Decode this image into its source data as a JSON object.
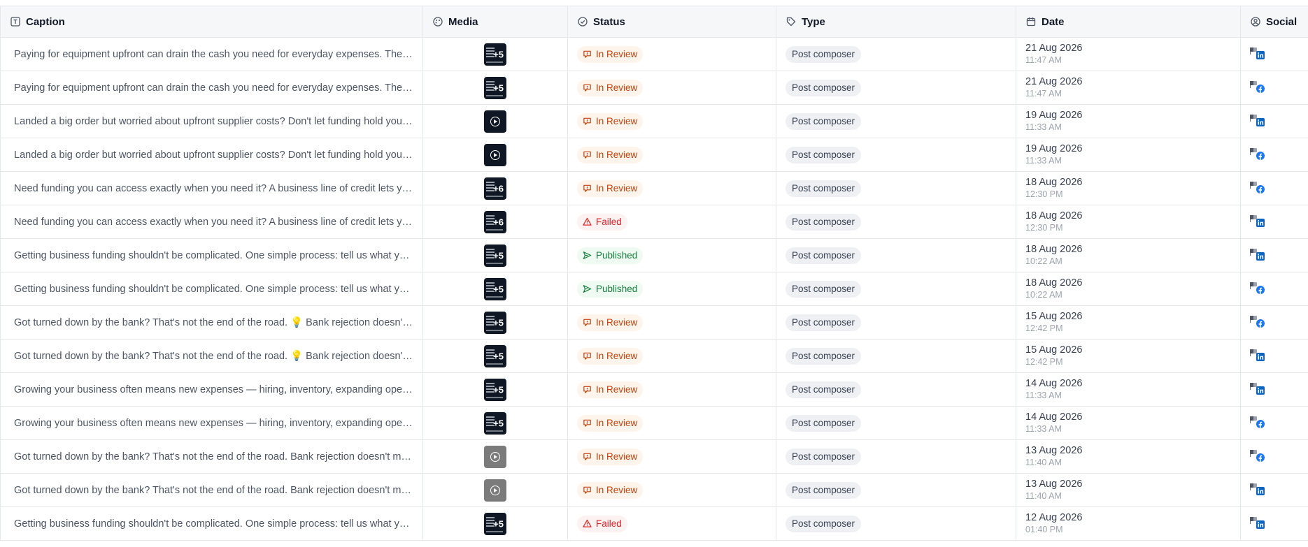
{
  "columns": {
    "caption": "Caption",
    "media": "Media",
    "status": "Status",
    "type": "Type",
    "date": "Date",
    "social": "Social"
  },
  "colors": {
    "in_review": "#c2410c",
    "failed": "#dc2626",
    "published": "#15803d",
    "linkedin": "#0a66c2",
    "facebook": "#1877f2"
  },
  "rows": [
    {
      "caption": "Paying for equipment upfront can drain the cash you need for everyday expenses. The equipment you need, when you need it.",
      "media_type": "image",
      "media_count": "+5",
      "status": "In Review",
      "type": "Post composer",
      "date": "21 Aug 2026",
      "time": "11:47 AM",
      "social": "linkedin-icon"
    },
    {
      "caption": "Paying for equipment upfront can drain the cash you need for everyday expenses. The equipment you need, when you need it.",
      "media_type": "image",
      "media_count": "+5",
      "status": "In Review",
      "type": "Post composer",
      "date": "21 Aug 2026",
      "time": "11:47 AM",
      "social": "facebook-icon"
    },
    {
      "caption": "Landed a big order but worried about upfront supplier costs? Don't let funding hold you back.",
      "media_type": "video",
      "media_count": "",
      "status": "In Review",
      "type": "Post composer",
      "date": "19 Aug 2026",
      "time": "11:33 AM",
      "social": "linkedin-icon"
    },
    {
      "caption": "Landed a big order but worried about upfront supplier costs? Don't let funding hold you back.",
      "media_type": "video",
      "media_count": "",
      "status": "In Review",
      "type": "Post composer",
      "date": "19 Aug 2026",
      "time": "11:33 AM",
      "social": "facebook-icon"
    },
    {
      "caption": "Need funding you can access exactly when you need it? A business line of credit lets you draw funds as needed.",
      "media_type": "image",
      "media_count": "+6",
      "status": "In Review",
      "type": "Post composer",
      "date": "18 Aug 2026",
      "time": "12:30 PM",
      "social": "facebook-icon"
    },
    {
      "caption": "Need funding you can access exactly when you need it? A business line of credit lets you draw funds as needed.",
      "media_type": "image",
      "media_count": "+6",
      "status": "Failed",
      "type": "Post composer",
      "date": "18 Aug 2026",
      "time": "12:30 PM",
      "social": "linkedin-icon"
    },
    {
      "caption": "Getting business funding shouldn't be complicated. One simple process: tell us what you need.",
      "media_type": "image",
      "media_count": "+5",
      "status": "Published",
      "type": "Post composer",
      "date": "18 Aug 2026",
      "time": "10:22 AM",
      "social": "linkedin-icon"
    },
    {
      "caption": "Getting business funding shouldn't be complicated. One simple process: tell us what you need.",
      "media_type": "image",
      "media_count": "+5",
      "status": "Published",
      "type": "Post composer",
      "date": "18 Aug 2026",
      "time": "10:22 AM",
      "social": "facebook-icon"
    },
    {
      "caption": "Got turned down by the bank? That's not the end of the road. 💡 Bank rejection doesn't mean no options.",
      "media_type": "image",
      "media_count": "+5",
      "status": "In Review",
      "type": "Post composer",
      "date": "15 Aug 2026",
      "time": "12:42 PM",
      "social": "facebook-icon"
    },
    {
      "caption": "Got turned down by the bank? That's not the end of the road. 💡 Bank rejection doesn't mean no options.",
      "media_type": "image",
      "media_count": "+5",
      "status": "In Review",
      "type": "Post composer",
      "date": "15 Aug 2026",
      "time": "12:42 PM",
      "social": "linkedin-icon"
    },
    {
      "caption": "Growing your business often means new expenses — hiring, inventory, expanding operations.",
      "media_type": "image",
      "media_count": "+5",
      "status": "In Review",
      "type": "Post composer",
      "date": "14 Aug 2026",
      "time": "11:33 AM",
      "social": "linkedin-icon"
    },
    {
      "caption": "Growing your business often means new expenses — hiring, inventory, expanding operations.",
      "media_type": "image",
      "media_count": "+5",
      "status": "In Review",
      "type": "Post composer",
      "date": "14 Aug 2026",
      "time": "11:33 AM",
      "social": "facebook-icon"
    },
    {
      "caption": "Got turned down by the bank? That's not the end of the road. Bank rejection doesn't mean no options.",
      "media_type": "video-gray",
      "media_count": "",
      "status": "In Review",
      "type": "Post composer",
      "date": "13 Aug 2026",
      "time": "11:40 AM",
      "social": "facebook-icon"
    },
    {
      "caption": "Got turned down by the bank? That's not the end of the road. Bank rejection doesn't mean no options.",
      "media_type": "video-gray",
      "media_count": "",
      "status": "In Review",
      "type": "Post composer",
      "date": "13 Aug 2026",
      "time": "11:40 AM",
      "social": "linkedin-icon"
    },
    {
      "caption": "Getting business funding shouldn't be complicated. One simple process: tell us what you need.",
      "media_type": "image",
      "media_count": "+5",
      "status": "Failed",
      "type": "Post composer",
      "date": "12 Aug 2026",
      "time": "01:40 PM",
      "social": "linkedin-icon"
    }
  ]
}
